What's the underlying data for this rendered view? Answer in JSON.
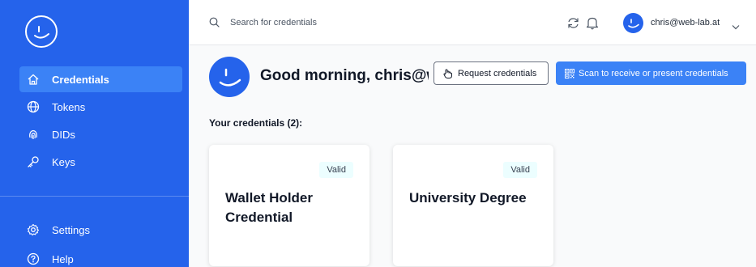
{
  "sidebar": {
    "items": [
      {
        "label": "Credentials",
        "icon": "home-icon",
        "active": true
      },
      {
        "label": "Tokens",
        "icon": "globe-icon"
      },
      {
        "label": "DIDs",
        "icon": "fingerprint-icon"
      },
      {
        "label": "Keys",
        "icon": "key-icon"
      },
      {
        "label": "Settings",
        "icon": "gear-icon"
      },
      {
        "label": "Help",
        "icon": "help-icon"
      }
    ]
  },
  "header": {
    "search_placeholder": "Search for credentials",
    "user_email": "chris@web-lab.at"
  },
  "main": {
    "greeting": "Good morning, chris@web-lab.at",
    "request_button": "Request credentials",
    "scan_button": "Scan to receive or present credentials",
    "section_heading": "Your credentials (2):",
    "credentials": [
      {
        "status": "Valid",
        "title": "Wallet Holder Credential"
      },
      {
        "status": "Valid",
        "title": "University Degree"
      }
    ]
  },
  "colors": {
    "primary": "#2563eb",
    "sidebar_active": "#3b82f6",
    "scan_button": "#3b82f6",
    "badge_bg": "#ecfeff"
  }
}
